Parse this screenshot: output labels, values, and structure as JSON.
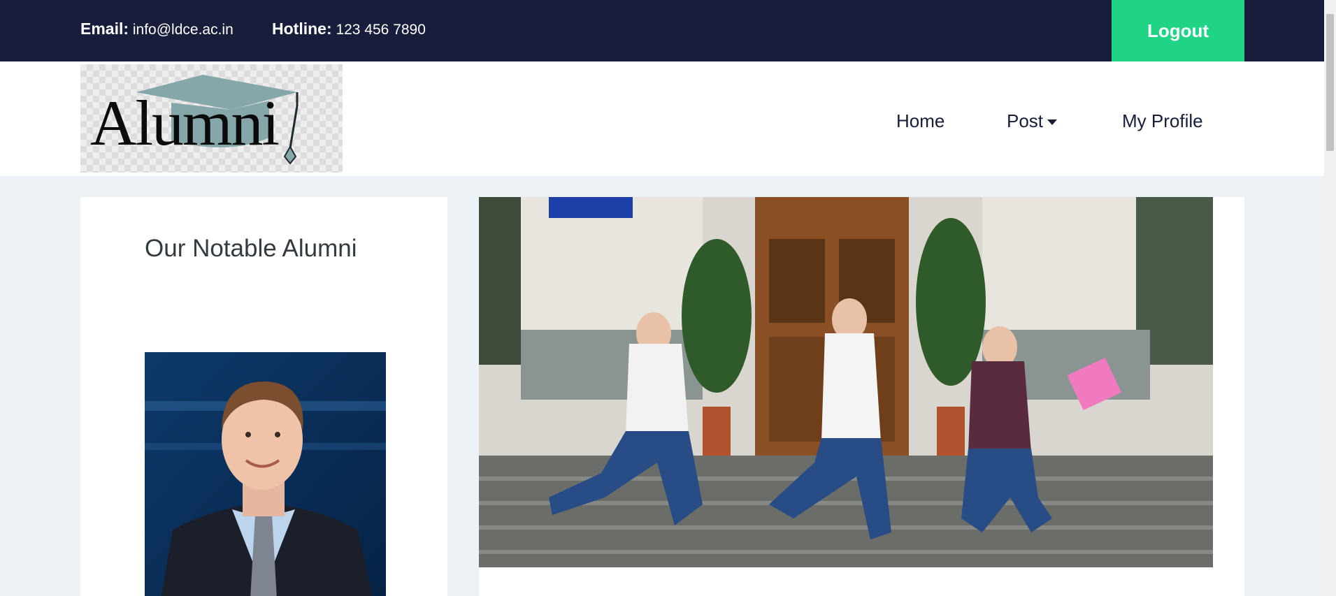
{
  "topbar": {
    "email_label": "Email:",
    "email_value": "info@ldce.ac.in",
    "hotline_label": "Hotline:",
    "hotline_value": "123 456 7890",
    "logout_label": "Logout"
  },
  "header": {
    "logo_text": "Alumni",
    "nav": {
      "home": "Home",
      "post": "Post",
      "profile": "My Profile"
    }
  },
  "sidebar": {
    "title": "Our Notable Alumni"
  },
  "colors": {
    "topbar_bg": "#171d3a",
    "accent_green": "#1fd485",
    "page_bg": "#edf2f6"
  },
  "icons": {
    "post_dropdown": "caret-down-icon"
  }
}
